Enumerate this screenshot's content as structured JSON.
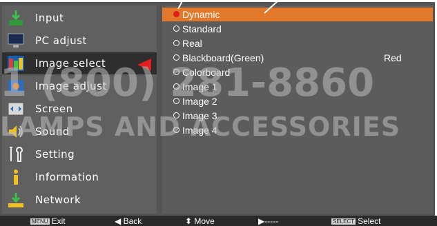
{
  "menu": [
    {
      "label": "Input",
      "icon": "input-icon"
    },
    {
      "label": "PC adjust",
      "icon": "pc-adjust-icon"
    },
    {
      "label": "Image select",
      "icon": "image-select-icon"
    },
    {
      "label": "Image adjust",
      "icon": "image-adjust-icon"
    },
    {
      "label": "Screen",
      "icon": "screen-icon"
    },
    {
      "label": "Sound",
      "icon": "sound-icon"
    },
    {
      "label": "Setting",
      "icon": "setting-icon"
    },
    {
      "label": "Information",
      "icon": "information-icon"
    },
    {
      "label": "Network",
      "icon": "network-icon"
    }
  ],
  "selected_menu": "Image select",
  "options": [
    {
      "label": "Dynamic",
      "selected": true
    },
    {
      "label": "Standard",
      "selected": false
    },
    {
      "label": "Real",
      "selected": false
    },
    {
      "label": "Blackboard(Green)",
      "selected": false
    },
    {
      "label": "Colorboard",
      "selected": false
    },
    {
      "label": "Image 1",
      "selected": false
    },
    {
      "label": "Image 2",
      "selected": false
    },
    {
      "label": "Image 3",
      "selected": false
    },
    {
      "label": "Image 4",
      "selected": false
    }
  ],
  "colorboard_value": "Red",
  "footer": {
    "exit_key": "MENU",
    "exit_label": "Exit",
    "back_label": "Back",
    "move_label": "Move",
    "next_label": "-----",
    "select_key": "SELECT",
    "select_label": "Select"
  },
  "watermark": {
    "line1": "1 (800) 281-8860",
    "line2": "LAMPS AND ACCESSORIES"
  },
  "colors": {
    "accent": "#e2792a",
    "pointer": "#e01e1e",
    "panel": "#545454"
  }
}
